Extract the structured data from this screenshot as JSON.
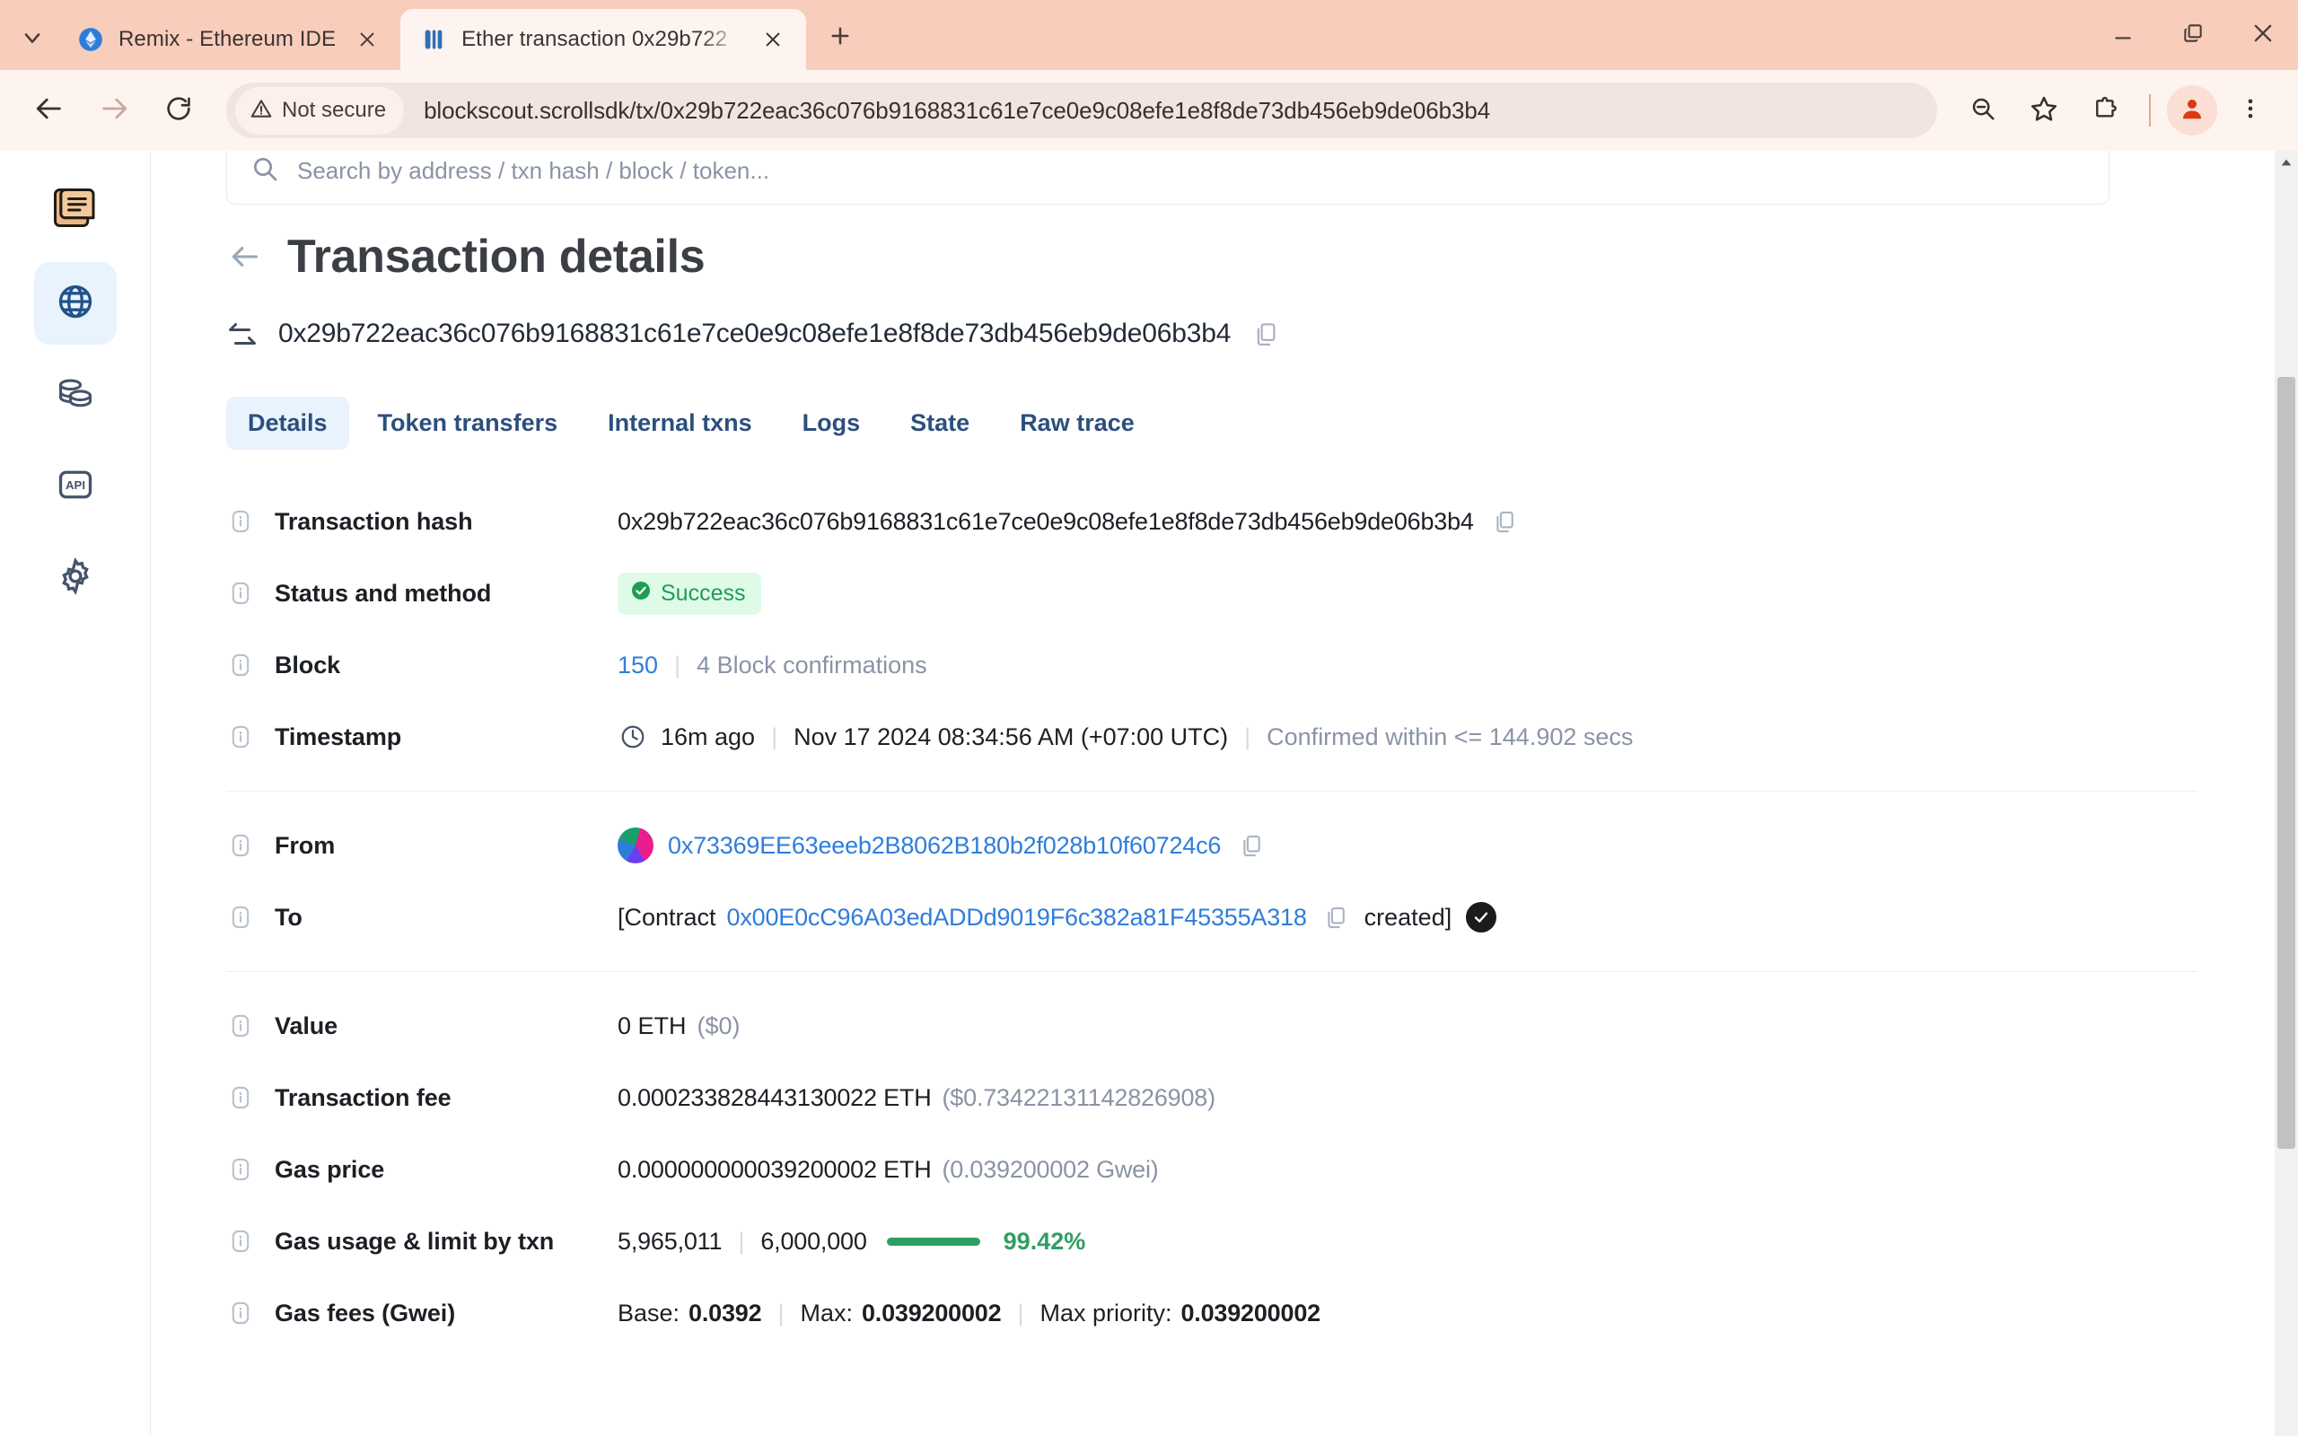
{
  "browser": {
    "tab_list_icon": "chevron-down-icon",
    "tabs": [
      {
        "title": "Remix - Ethereum IDE",
        "favicon": "ethereum-icon",
        "active": false
      },
      {
        "title": "Ether transaction 0x29b722",
        "favicon": "blockscout-icon",
        "active": true
      }
    ],
    "new_tab_label": "+",
    "window": {
      "minimize": "minimize-icon",
      "maximize": "restore-icon",
      "close": "close-icon"
    },
    "toolbar": {
      "back": "back-arrow-icon",
      "forward": "forward-arrow-icon",
      "reload": "reload-icon",
      "security_label": "Not secure",
      "url": "blockscout.scrollsdk/tx/0x29b722eac36c076b9168831c61e7ce0e9c08efe1e8f8de73db456eb9de06b3b4",
      "zoom_out": "zoom-out-icon",
      "bookmark": "star-icon",
      "extensions": "puzzle-icon",
      "profile": "profile-avatar-icon",
      "menu": "three-dot-menu-icon"
    }
  },
  "sidebar": {
    "logo": "scroll-logo-icon",
    "items": [
      {
        "name": "blockchain",
        "icon": "globe-icon",
        "active": true
      },
      {
        "name": "tokens",
        "icon": "coins-icon",
        "active": false
      },
      {
        "name": "api",
        "icon": "api-icon",
        "active": false
      },
      {
        "name": "settings",
        "icon": "gear-icon",
        "active": false
      }
    ]
  },
  "search": {
    "icon": "search-icon",
    "placeholder": "Search by address / txn hash / block / token...",
    "value": ""
  },
  "page": {
    "back_icon": "back-arrow-icon",
    "title": "Transaction details",
    "hash_icon": "transaction-arrows-icon",
    "hash": "0x29b722eac36c076b9168831c61e7ce0e9c08efe1e8f8de73db456eb9de06b3b4",
    "copy_icon": "copy-icon"
  },
  "tabs": [
    {
      "label": "Details",
      "active": true
    },
    {
      "label": "Token transfers",
      "active": false
    },
    {
      "label": "Internal txns",
      "active": false
    },
    {
      "label": "Logs",
      "active": false
    },
    {
      "label": "State",
      "active": false
    },
    {
      "label": "Raw trace",
      "active": false
    }
  ],
  "details": {
    "transaction_hash": {
      "label": "Transaction hash",
      "value": "0x29b722eac36c076b9168831c61e7ce0e9c08efe1e8f8de73db456eb9de06b3b4"
    },
    "status_and_method": {
      "label": "Status and method",
      "status": "Success"
    },
    "block": {
      "label": "Block",
      "number": "150",
      "confirmations": "4 Block confirmations"
    },
    "timestamp": {
      "label": "Timestamp",
      "relative": "16m ago",
      "absolute": "Nov 17 2024 08:34:56 AM (+07:00 UTC)",
      "confirmed": "Confirmed within <= 144.902 secs"
    },
    "from": {
      "label": "From",
      "address": "0x73369EE63eeeb2B8062B180b2f028b10f60724c6"
    },
    "to": {
      "label": "To",
      "prefix": "[Contract",
      "address": "0x00E0cC96A03edADDd9019F6c382a81F45355A318",
      "suffix": "created]"
    },
    "value": {
      "label": "Value",
      "amount": "0 ETH",
      "usd": "($0)"
    },
    "transaction_fee": {
      "label": "Transaction fee",
      "amount": "0.000233828443130022 ETH",
      "usd": "($0.73422131142826908)"
    },
    "gas_price": {
      "label": "Gas price",
      "amount": "0.000000000039200002 ETH",
      "gwei": "(0.039200002 Gwei)"
    },
    "gas_usage": {
      "label": "Gas usage & limit by txn",
      "used": "5,965,011",
      "limit": "6,000,000",
      "percent": "99.42%"
    },
    "gas_fees": {
      "label": "Gas fees (Gwei)",
      "base_label": "Base:",
      "base": "0.0392",
      "max_label": "Max:",
      "max": "0.039200002",
      "max_priority_label": "Max priority:",
      "max_priority": "0.039200002"
    }
  },
  "colors": {
    "chrome_bg": "#f8cdbc",
    "toolbar_bg": "#fdf4f0",
    "link": "#2f7ddb",
    "tab_accent": "#2c4f7c",
    "success": "#1f9d55",
    "gas_green": "#2f9e63",
    "muted": "#8a93a5"
  }
}
